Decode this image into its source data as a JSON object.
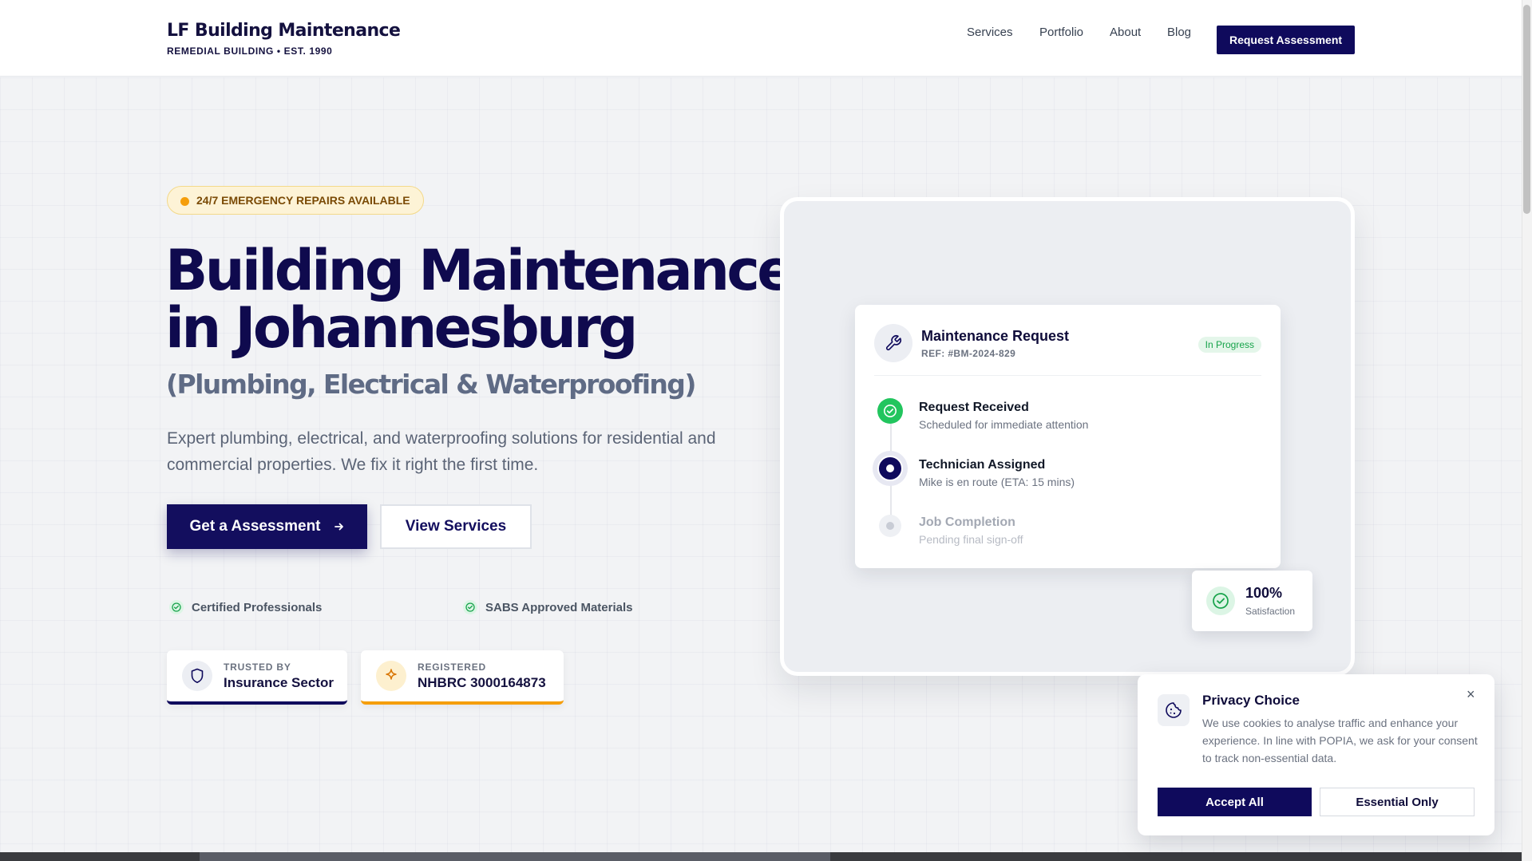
{
  "brand": {
    "name": "LF Building Maintenance",
    "tagline": "REMEDIAL BUILDING • EST. 1990"
  },
  "nav": {
    "items": [
      "Services",
      "Portfolio",
      "About",
      "Blog"
    ],
    "cta": "Request Assessment"
  },
  "hero": {
    "badge": "24/7 EMERGENCY REPAIRS AVAILABLE",
    "title_a": "Building ",
    "title_highlight": "Maintenance",
    "title_b": "in Johannesburg",
    "subtitle": "(Plumbing, Electrical & Waterproofing)",
    "lead": "Expert plumbing, electrical, and waterproofing solutions for residential and commercial properties. We fix it right the first time.",
    "primary_cta": "Get a Assessment",
    "secondary_cta": "View Services",
    "features": [
      "Certified Professionals",
      "SABS Approved Materials"
    ],
    "trust": [
      {
        "small": "TRUSTED BY",
        "big": "Insurance Sector",
        "icon": "shield-icon",
        "accent": "#0f0a5c"
      },
      {
        "small": "REGISTERED",
        "big": "NHBRC 3000164873",
        "icon": "sparkle-icon",
        "accent": "#f59e0b"
      }
    ]
  },
  "request_card": {
    "title": "Maintenance Request",
    "ref": "REF: #BM-2024-829",
    "status": "In Progress",
    "steps": [
      {
        "title": "Request Received",
        "sub": "Scheduled for immediate attention",
        "state": "done"
      },
      {
        "title": "Technician Assigned",
        "sub": "Mike is en route (ETA: 15 mins)",
        "state": "active"
      },
      {
        "title": "Job Completion",
        "sub": "Pending final sign-off",
        "state": "pending"
      }
    ]
  },
  "satisfaction": {
    "value": "100%",
    "label": "Satisfaction"
  },
  "cookie": {
    "title": "Privacy Choice",
    "body": "We use cookies to analyse traffic and enhance your experience. In line with POPIA, we ask for your consent to track non-essential data.",
    "accept": "Accept All",
    "essential": "Essential Only",
    "close": "×"
  },
  "colors": {
    "primary": "#0f0a5c",
    "accent": "#f59e0b",
    "success": "#16a34a"
  }
}
